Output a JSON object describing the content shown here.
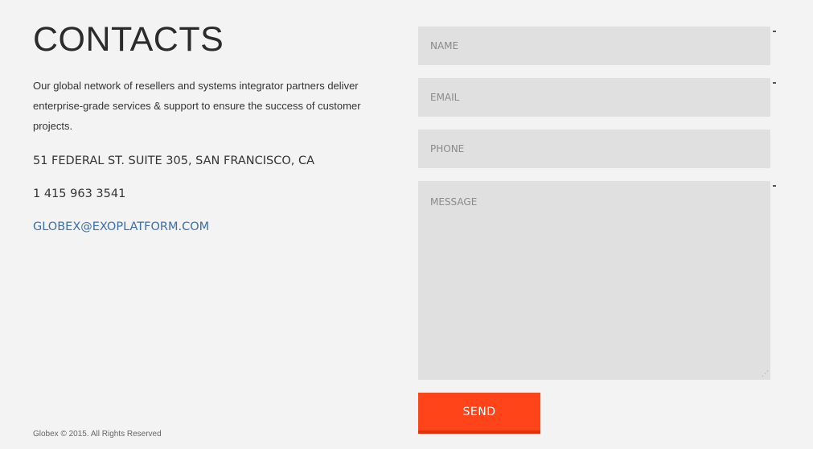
{
  "contacts": {
    "title": "CONTACTS",
    "intro": "Our global network of resellers and systems integrator partners deliver enterprise-grade services & support to ensure the success of customer projects.",
    "address": "51 FEDERAL ST. SUITE 305, SAN FRANCISCO, CA",
    "phone": "1 415 963 3541",
    "email": "GLOBEX@EXOPLATFORM.COM"
  },
  "form": {
    "name_placeholder": "NAME",
    "email_placeholder": "EMAIL",
    "phone_placeholder": "PHONE",
    "message_placeholder": "MESSAGE",
    "send_label": "SEND"
  },
  "footer": {
    "copyright": "Globex © 2015. All Rights Reserved"
  },
  "colors": {
    "background": "#f3f3f3",
    "field_background": "#e0e0e0",
    "accent": "#ff4419",
    "link": "#3b6ea5"
  }
}
